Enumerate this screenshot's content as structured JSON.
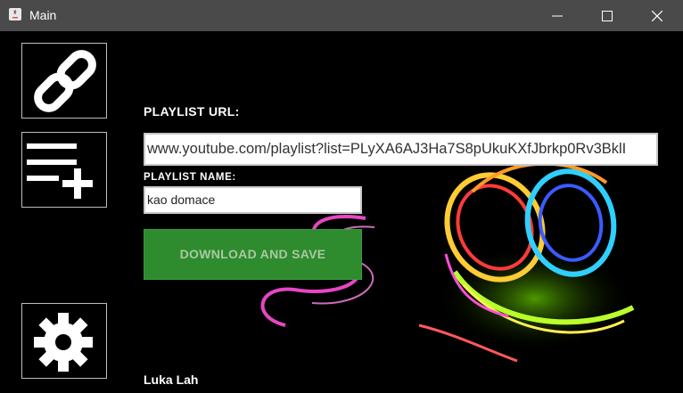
{
  "window": {
    "title": "Main",
    "icons": {
      "app": "java-icon",
      "minimize": "minimize-icon",
      "maximize": "maximize-icon",
      "close": "close-icon"
    }
  },
  "sidebar": {
    "items": [
      {
        "name": "link",
        "icon": "link-icon"
      },
      {
        "name": "playlist-add",
        "icon": "playlist-add-icon"
      },
      {
        "name": "settings",
        "icon": "gear-icon"
      }
    ]
  },
  "form": {
    "url_label": "PLAYLIST URL:",
    "url_value": "www.youtube.com/playlist?list=PLyXA6AJ3Ha7S8pUkuKXfJbrkp0Rv3BklI",
    "name_label": "PLAYLIST NAME:",
    "name_value": "kao domace",
    "download_label": "DOWNLOAD AND SAVE"
  },
  "footer": {
    "author": "Luka Lah"
  },
  "colors": {
    "titlebar": "#4a4a4a",
    "background": "#000000",
    "download_button": "#2e8b2e",
    "download_text": "#a9c9a2"
  }
}
